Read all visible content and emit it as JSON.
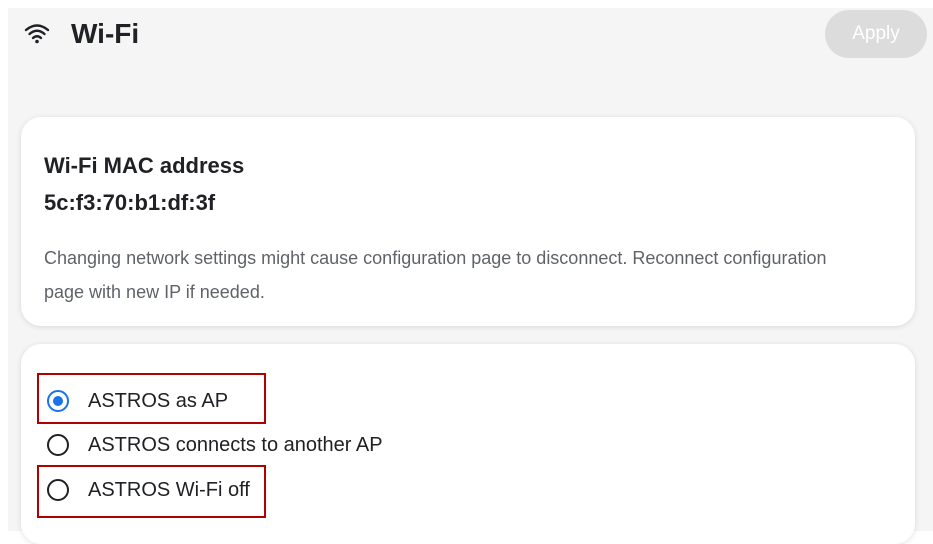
{
  "header": {
    "title": "Wi-Fi",
    "icon": "wifi-icon",
    "apply_label": "Apply"
  },
  "info_card": {
    "mac_label": "Wi-Fi MAC address",
    "mac_value": "5c:f3:70:b1:df:3f",
    "notice": "Changing network settings might cause configuration page to disconnect. Reconnect configuration page with new IP if needed."
  },
  "mode_card": {
    "options": [
      {
        "label": "ASTROS as AP",
        "selected": true
      },
      {
        "label": "ASTROS connects to another AP",
        "selected": false
      },
      {
        "label": "ASTROS Wi-Fi off",
        "selected": false
      }
    ]
  },
  "colors": {
    "accent": "#1a73e8",
    "highlight": "#b00000",
    "apply_disabled": "#dcdcdc"
  }
}
